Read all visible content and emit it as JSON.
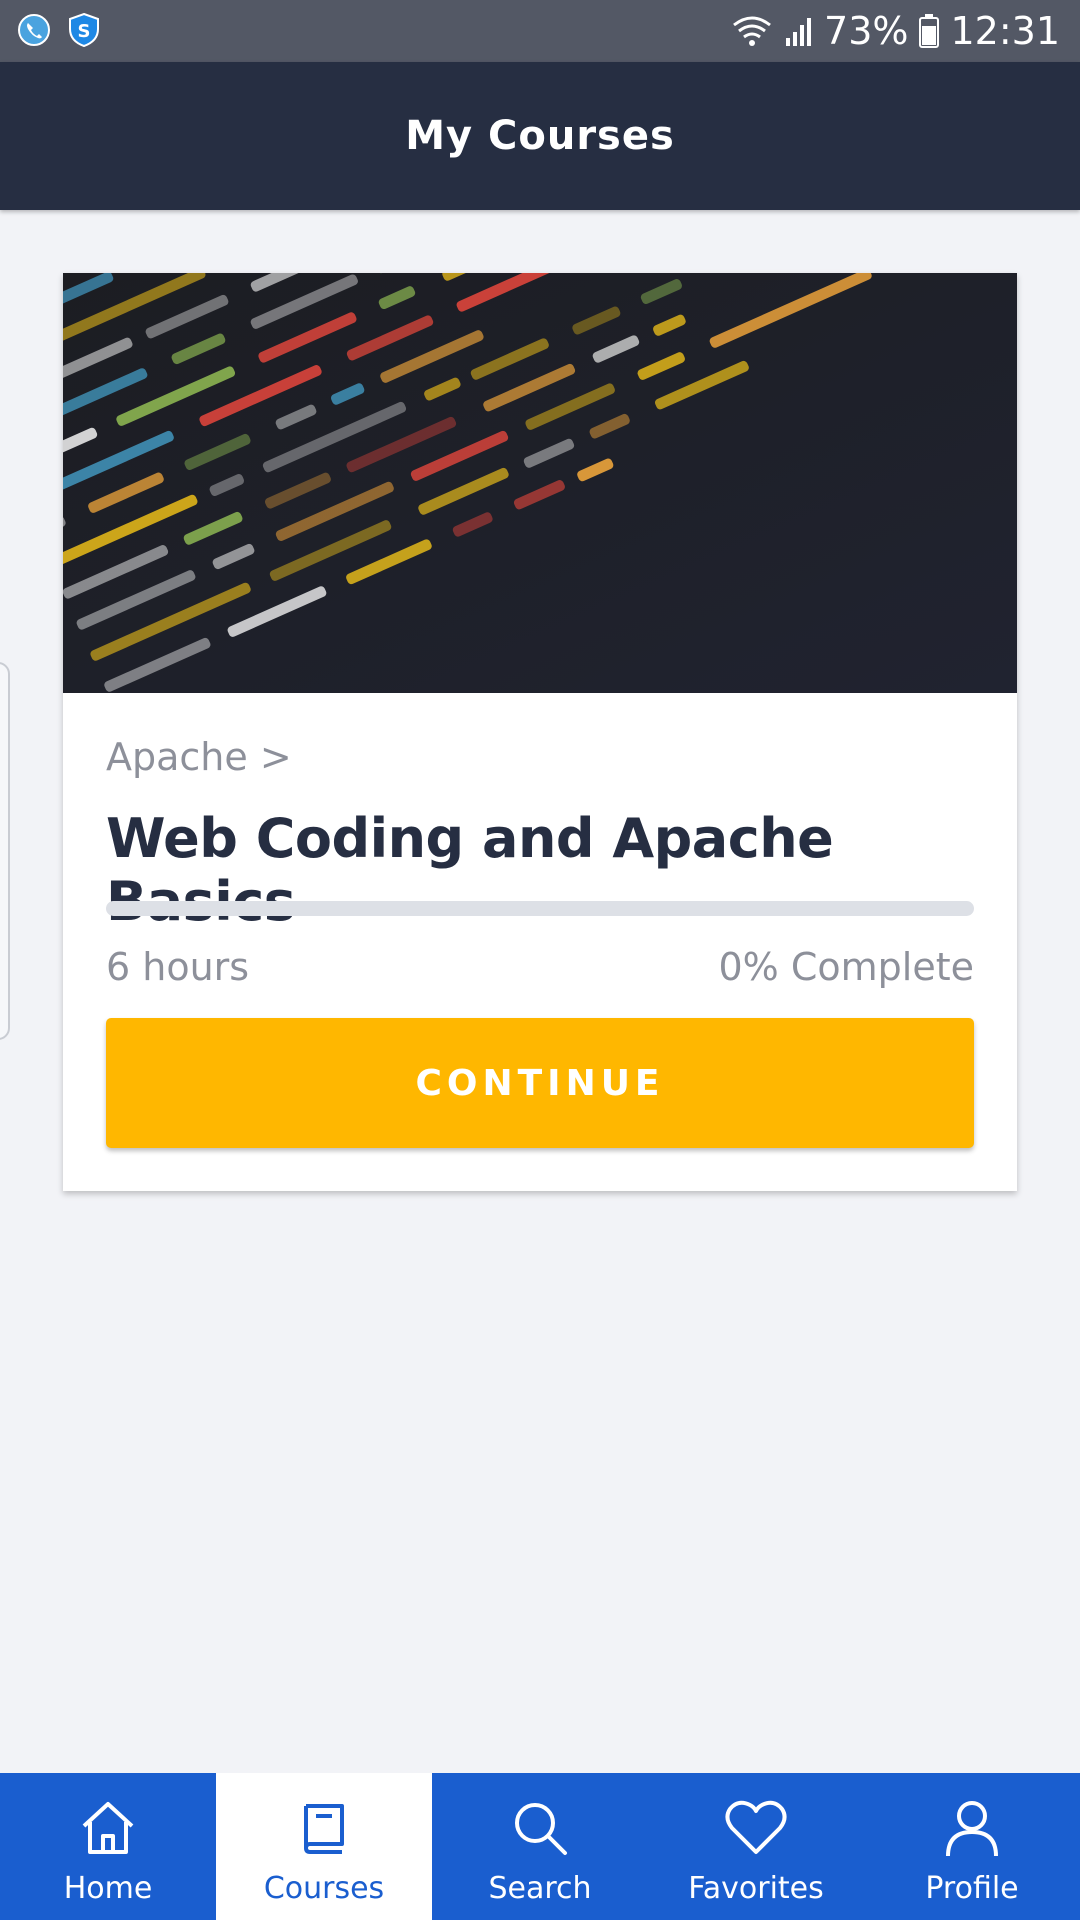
{
  "status_bar": {
    "battery": "73%",
    "time": "12:31"
  },
  "header": {
    "title": "My Courses"
  },
  "course": {
    "category": "Apache >",
    "title": "Web Coding and Apache Basics",
    "duration": "6 hours",
    "completion": "0% Complete",
    "progress_fraction": 0,
    "continue_label": "CONTINUE"
  },
  "bottom_nav": {
    "items": [
      {
        "label": "Home",
        "icon": "home-icon"
      },
      {
        "label": "Courses",
        "icon": "book-icon",
        "active": true
      },
      {
        "label": "Search",
        "icon": "search-icon"
      },
      {
        "label": "Favorites",
        "icon": "heart-icon"
      },
      {
        "label": "Profile",
        "icon": "person-icon"
      }
    ]
  },
  "colors": {
    "header_bg": "#262e42",
    "accent": "#ffb700",
    "nav_bg": "#1a5ecf",
    "status_bar_bg": "#535865"
  }
}
